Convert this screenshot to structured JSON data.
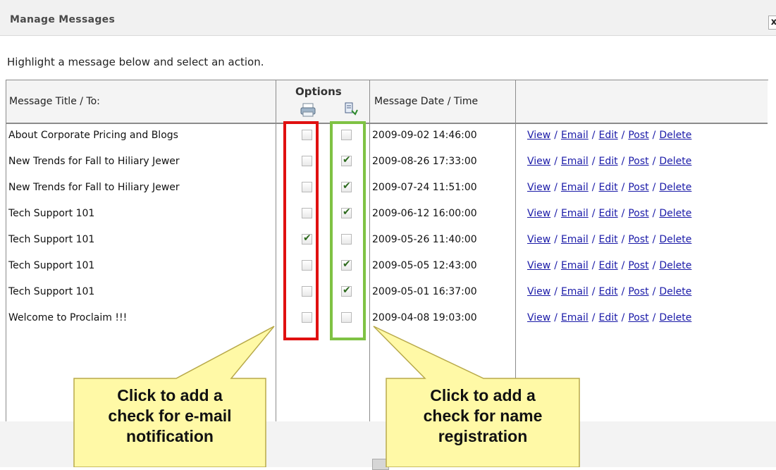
{
  "dialog": {
    "title": "Manage Messages",
    "close_label": "x",
    "instruction": "Highlight a message below and select an action."
  },
  "table": {
    "columns": {
      "title": "Message Title / To:",
      "options": "Options",
      "date": "Message Date / Time",
      "actions": ""
    },
    "option_icons": [
      "email-notification-icon",
      "name-registration-icon"
    ],
    "action_links": [
      "View",
      "Email",
      "Edit",
      "Post",
      "Delete"
    ],
    "rows": [
      {
        "title": "About Corporate Pricing and Blogs",
        "email_notify": false,
        "name_reg": false,
        "date": "2009-09-02 14:46:00"
      },
      {
        "title": "New Trends for Fall to Hiliary Jewer",
        "email_notify": false,
        "name_reg": true,
        "date": "2009-08-26 17:33:00"
      },
      {
        "title": "New Trends for Fall to Hiliary Jewer",
        "email_notify": false,
        "name_reg": true,
        "date": "2009-07-24 11:51:00"
      },
      {
        "title": "Tech Support 101",
        "email_notify": false,
        "name_reg": true,
        "date": "2009-06-12 16:00:00"
      },
      {
        "title": "Tech Support 101",
        "email_notify": true,
        "name_reg": false,
        "date": "2009-05-26 11:40:00"
      },
      {
        "title": "Tech Support 101",
        "email_notify": false,
        "name_reg": true,
        "date": "2009-05-05 12:43:00"
      },
      {
        "title": "Tech Support 101",
        "email_notify": false,
        "name_reg": true,
        "date": "2009-05-01 16:37:00"
      },
      {
        "title": "Welcome to Proclaim !!!",
        "email_notify": false,
        "name_reg": false,
        "date": "2009-04-08 19:03:00"
      }
    ]
  },
  "callouts": {
    "email": [
      "Click to add a",
      "check for e-mail",
      "notification"
    ],
    "name": [
      "Click to add a",
      "check for name",
      "registration"
    ]
  },
  "colors": {
    "highlight_email": "#e01010",
    "highlight_name": "#7fc244",
    "callout_fill": "#fff9a6",
    "link": "#1a1aa8"
  }
}
